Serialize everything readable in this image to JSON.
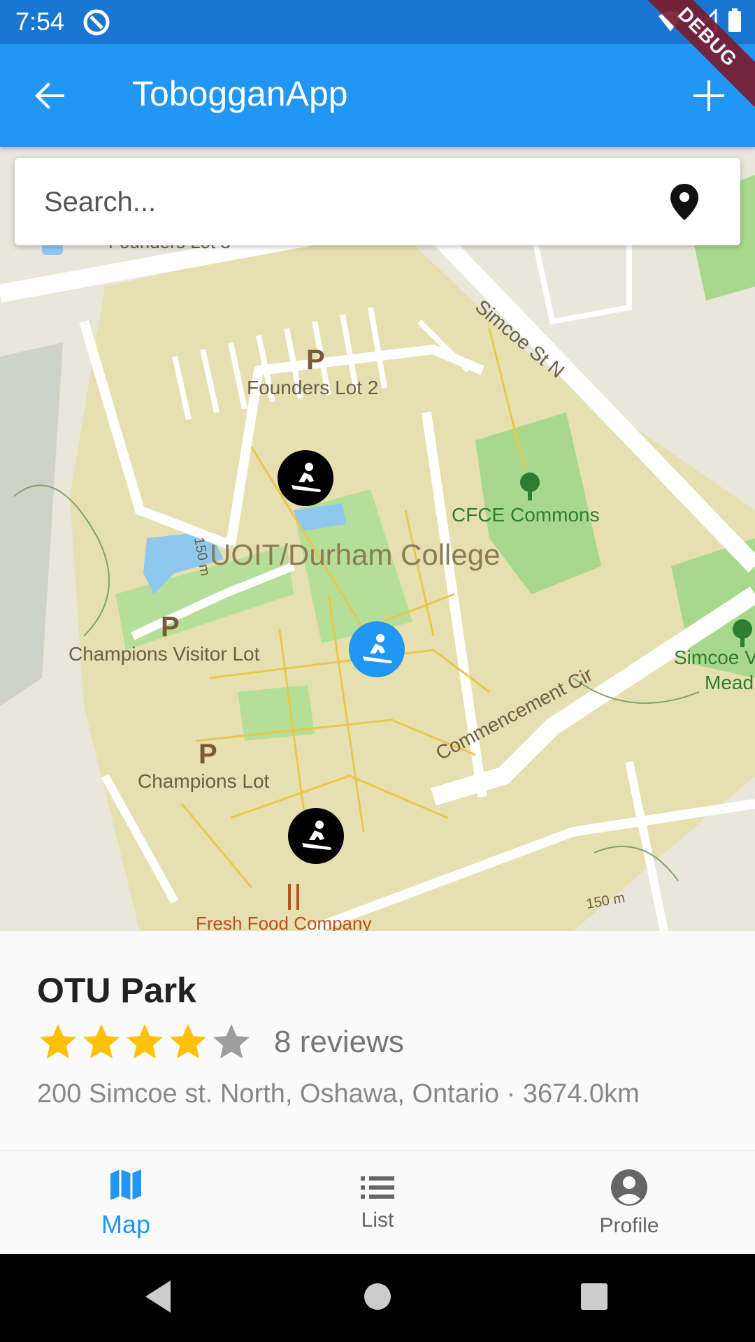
{
  "status_bar": {
    "time": "7:54"
  },
  "debug_banner": "DEBUG",
  "app_bar": {
    "title": "TobogganApp"
  },
  "search": {
    "placeholder": "Search..."
  },
  "map": {
    "labels": {
      "founders_lot_3": "Founders Lot 3",
      "founders_lot_2": "Founders Lot 2",
      "simcoe_st": "Simcoe St N",
      "cfce": "CFCE Commons",
      "campus": "UOIT/Durham College",
      "champions_visitor": "Champions Visitor Lot",
      "champions_lot": "Champions Lot",
      "commencement": "Commencement Cir",
      "simcoe_meadow_1": "Simcoe V",
      "simcoe_meadow_2": "Mead",
      "fresh_food": "Fresh Food Company",
      "scale_1": "150 m",
      "scale_2": "150 m",
      "parking": "P"
    }
  },
  "place": {
    "name": "OTU Park",
    "rating": 4,
    "rating_max": 5,
    "reviews": "8 reviews",
    "address": "200 Simcoe st. North, Oshawa, Ontario · 3674.0km"
  },
  "nav": {
    "map": "Map",
    "list": "List",
    "profile": "Profile"
  },
  "colors": {
    "primary": "#2196f3",
    "status_bar": "#1976d2",
    "star_filled": "#ffc107",
    "star_empty": "#9e9e9e"
  }
}
